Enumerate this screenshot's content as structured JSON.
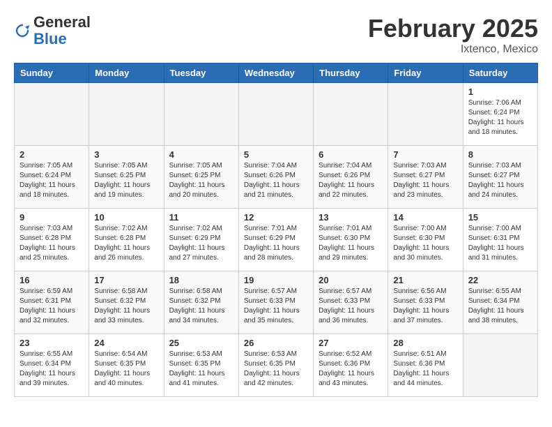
{
  "logo": {
    "general": "General",
    "blue": "Blue"
  },
  "header": {
    "month_title": "February 2025",
    "location": "Ixtenco, Mexico"
  },
  "weekdays": [
    "Sunday",
    "Monday",
    "Tuesday",
    "Wednesday",
    "Thursday",
    "Friday",
    "Saturday"
  ],
  "weeks": [
    [
      {
        "day": "",
        "info": ""
      },
      {
        "day": "",
        "info": ""
      },
      {
        "day": "",
        "info": ""
      },
      {
        "day": "",
        "info": ""
      },
      {
        "day": "",
        "info": ""
      },
      {
        "day": "",
        "info": ""
      },
      {
        "day": "1",
        "info": "Sunrise: 7:06 AM\nSunset: 6:24 PM\nDaylight: 11 hours\nand 18 minutes."
      }
    ],
    [
      {
        "day": "2",
        "info": "Sunrise: 7:05 AM\nSunset: 6:24 PM\nDaylight: 11 hours\nand 18 minutes."
      },
      {
        "day": "3",
        "info": "Sunrise: 7:05 AM\nSunset: 6:25 PM\nDaylight: 11 hours\nand 19 minutes."
      },
      {
        "day": "4",
        "info": "Sunrise: 7:05 AM\nSunset: 6:25 PM\nDaylight: 11 hours\nand 20 minutes."
      },
      {
        "day": "5",
        "info": "Sunrise: 7:04 AM\nSunset: 6:26 PM\nDaylight: 11 hours\nand 21 minutes."
      },
      {
        "day": "6",
        "info": "Sunrise: 7:04 AM\nSunset: 6:26 PM\nDaylight: 11 hours\nand 22 minutes."
      },
      {
        "day": "7",
        "info": "Sunrise: 7:03 AM\nSunset: 6:27 PM\nDaylight: 11 hours\nand 23 minutes."
      },
      {
        "day": "8",
        "info": "Sunrise: 7:03 AM\nSunset: 6:27 PM\nDaylight: 11 hours\nand 24 minutes."
      }
    ],
    [
      {
        "day": "9",
        "info": "Sunrise: 7:03 AM\nSunset: 6:28 PM\nDaylight: 11 hours\nand 25 minutes."
      },
      {
        "day": "10",
        "info": "Sunrise: 7:02 AM\nSunset: 6:28 PM\nDaylight: 11 hours\nand 26 minutes."
      },
      {
        "day": "11",
        "info": "Sunrise: 7:02 AM\nSunset: 6:29 PM\nDaylight: 11 hours\nand 27 minutes."
      },
      {
        "day": "12",
        "info": "Sunrise: 7:01 AM\nSunset: 6:29 PM\nDaylight: 11 hours\nand 28 minutes."
      },
      {
        "day": "13",
        "info": "Sunrise: 7:01 AM\nSunset: 6:30 PM\nDaylight: 11 hours\nand 29 minutes."
      },
      {
        "day": "14",
        "info": "Sunrise: 7:00 AM\nSunset: 6:30 PM\nDaylight: 11 hours\nand 30 minutes."
      },
      {
        "day": "15",
        "info": "Sunrise: 7:00 AM\nSunset: 6:31 PM\nDaylight: 11 hours\nand 31 minutes."
      }
    ],
    [
      {
        "day": "16",
        "info": "Sunrise: 6:59 AM\nSunset: 6:31 PM\nDaylight: 11 hours\nand 32 minutes."
      },
      {
        "day": "17",
        "info": "Sunrise: 6:58 AM\nSunset: 6:32 PM\nDaylight: 11 hours\nand 33 minutes."
      },
      {
        "day": "18",
        "info": "Sunrise: 6:58 AM\nSunset: 6:32 PM\nDaylight: 11 hours\nand 34 minutes."
      },
      {
        "day": "19",
        "info": "Sunrise: 6:57 AM\nSunset: 6:33 PM\nDaylight: 11 hours\nand 35 minutes."
      },
      {
        "day": "20",
        "info": "Sunrise: 6:57 AM\nSunset: 6:33 PM\nDaylight: 11 hours\nand 36 minutes."
      },
      {
        "day": "21",
        "info": "Sunrise: 6:56 AM\nSunset: 6:33 PM\nDaylight: 11 hours\nand 37 minutes."
      },
      {
        "day": "22",
        "info": "Sunrise: 6:55 AM\nSunset: 6:34 PM\nDaylight: 11 hours\nand 38 minutes."
      }
    ],
    [
      {
        "day": "23",
        "info": "Sunrise: 6:55 AM\nSunset: 6:34 PM\nDaylight: 11 hours\nand 39 minutes."
      },
      {
        "day": "24",
        "info": "Sunrise: 6:54 AM\nSunset: 6:35 PM\nDaylight: 11 hours\nand 40 minutes."
      },
      {
        "day": "25",
        "info": "Sunrise: 6:53 AM\nSunset: 6:35 PM\nDaylight: 11 hours\nand 41 minutes."
      },
      {
        "day": "26",
        "info": "Sunrise: 6:53 AM\nSunset: 6:35 PM\nDaylight: 11 hours\nand 42 minutes."
      },
      {
        "day": "27",
        "info": "Sunrise: 6:52 AM\nSunset: 6:36 PM\nDaylight: 11 hours\nand 43 minutes."
      },
      {
        "day": "28",
        "info": "Sunrise: 6:51 AM\nSunset: 6:36 PM\nDaylight: 11 hours\nand 44 minutes."
      },
      {
        "day": "",
        "info": ""
      }
    ]
  ]
}
